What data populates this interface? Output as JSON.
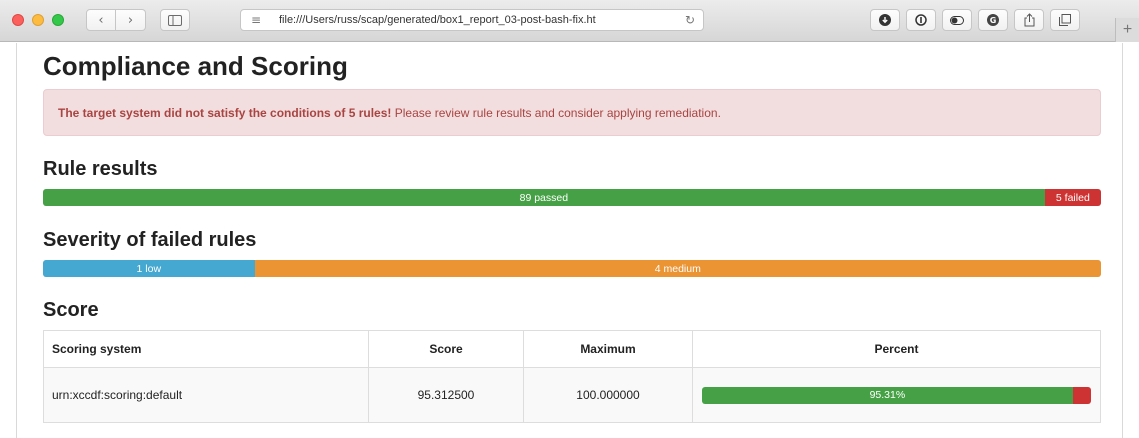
{
  "browser": {
    "url": "file:///Users/russ/scap/generated/box1_report_03-post-bash-fix.ht"
  },
  "page": {
    "title": "Compliance and Scoring",
    "alert": {
      "bold": "The target system did not satisfy the conditions of 5 rules!",
      "text": " Please review rule results and consider applying remediation."
    },
    "rule_results": {
      "heading": "Rule results",
      "passed_label": "89 passed",
      "failed_label": "5 failed",
      "passed_count": 89,
      "failed_count": 5
    },
    "severity": {
      "heading": "Severity of failed rules",
      "low_label": "1 low",
      "medium_label": "4 medium",
      "low_count": 1,
      "medium_count": 4
    },
    "score": {
      "heading": "Score",
      "columns": [
        "Scoring system",
        "Score",
        "Maximum",
        "Percent"
      ],
      "rows": [
        {
          "system": "urn:xccdf:scoring:default",
          "score": "95.312500",
          "maximum": "100.000000",
          "percent_label": "95.31%",
          "percent": 95.31
        }
      ]
    }
  },
  "colors": {
    "pass": "#46a146",
    "fail": "#cd3333",
    "low": "#44a8d0",
    "medium": "#ea9434",
    "alert_bg": "#f2dede",
    "alert_text": "#a94442"
  },
  "icons": [
    "close-window-icon",
    "minimize-window-icon",
    "maximize-window-icon",
    "back-arrow-icon",
    "forward-arrow-icon",
    "sidebar-icon",
    "reader-menu-icon",
    "reload-icon",
    "download-icon",
    "password-icon",
    "toggle-icon",
    "grammarly-icon",
    "share-icon",
    "tabs-icon",
    "new-tab-plus-icon"
  ]
}
